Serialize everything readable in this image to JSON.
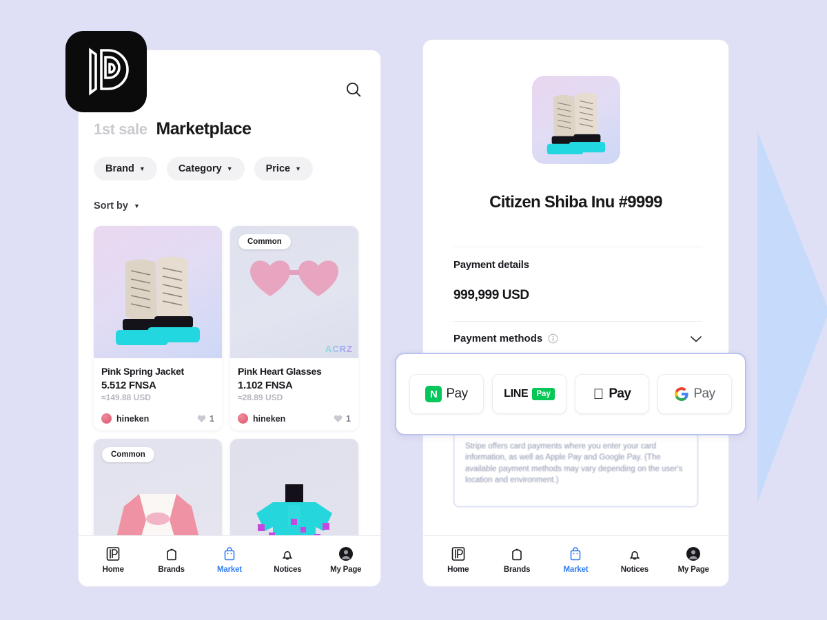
{
  "background_color": "#dfe0f5",
  "accent_color": "#2f7df6",
  "left_phone": {
    "logo_icon": "app-logo-d-mark",
    "search_icon": "search-icon",
    "header": {
      "eyebrow": "1st sale",
      "title": "Marketplace"
    },
    "filters": [
      {
        "label": "Brand",
        "icon": "chevron-down-icon"
      },
      {
        "label": "Category",
        "icon": "chevron-down-icon"
      },
      {
        "label": "Price",
        "icon": "chevron-down-icon"
      }
    ],
    "sort": {
      "label": "Sort by",
      "icon": "chevron-down-icon"
    },
    "products": [
      {
        "name": "Pink Spring Jacket",
        "price": "5.512 FNSA",
        "price_usd": "≈149.88 USD",
        "seller": "hineken",
        "likes": "1",
        "badge": "",
        "watermark": "",
        "media": "boots-thumbnail"
      },
      {
        "name": "Pink Heart Glasses",
        "price": "1.102 FNSA",
        "price_usd": "≈28.89 USD",
        "seller": "hineken",
        "likes": "1",
        "badge": "Common",
        "watermark": "ACRZ",
        "media": "heart-glasses-thumbnail"
      },
      {
        "name": "",
        "price": "",
        "price_usd": "",
        "seller": "",
        "likes": "",
        "badge": "Common",
        "watermark": "",
        "media": "pink-jacket-thumbnail"
      },
      {
        "name": "",
        "price": "",
        "price_usd": "",
        "seller": "",
        "likes": "",
        "badge": "",
        "watermark": "",
        "media": "cyan-top-thumbnail"
      }
    ]
  },
  "right_phone": {
    "product": {
      "title": "Citizen Shiba Inu #9999",
      "media": "boots-thumbnail"
    },
    "payment_details_label": "Payment details",
    "payment_amount": "999,999 USD",
    "payment_methods_label": "Payment methods",
    "payment_methods_info_icon": "info-circle-icon",
    "payment_methods_chevron_icon": "chevron-down-icon",
    "stripe_note": "Stripe offers card payments where you enter your card information, as well as Apple Pay and Google Pay. (The available payment methods may vary depending on the user's location and environment.)"
  },
  "payment_overlay": {
    "methods": [
      {
        "id": "naver-pay",
        "mark": "N",
        "label": "Pay",
        "mark_color": "#03c75a"
      },
      {
        "id": "line-pay",
        "mark": "LINE",
        "label": "Pay",
        "mark_color": "#06c755"
      },
      {
        "id": "apple-pay",
        "mark": "apple-logo-icon",
        "label": "Pay",
        "mark_color": "#000000"
      },
      {
        "id": "google-pay",
        "mark": "G",
        "label": "Pay",
        "mark_color": "#4285f4"
      }
    ]
  },
  "bottom_nav": {
    "items": [
      {
        "label": "Home",
        "icon": "home-logo-icon",
        "active": false
      },
      {
        "label": "Brands",
        "icon": "tag-icon",
        "active": false
      },
      {
        "label": "Market",
        "icon": "shopping-bag-icon",
        "active": true
      },
      {
        "label": "Notices",
        "icon": "bell-icon",
        "active": false
      },
      {
        "label": "My Page",
        "icon": "avatar-icon",
        "active": false
      }
    ]
  },
  "decoration": {
    "arrow_icon": "right-arrow-decoration",
    "arrow_color": "#c6dbfb"
  }
}
